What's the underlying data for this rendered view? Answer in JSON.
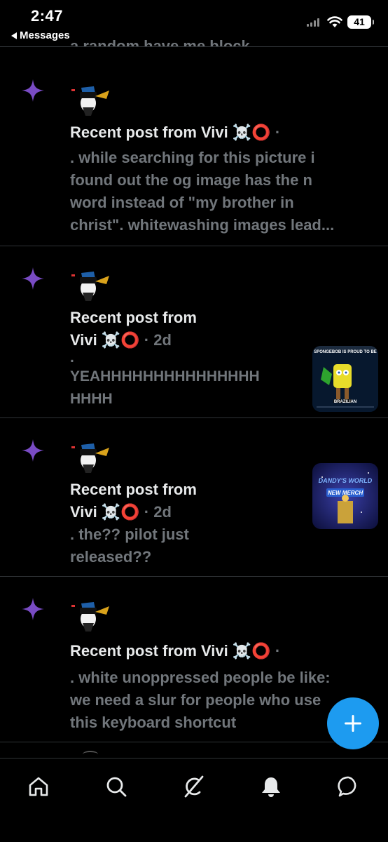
{
  "status_bar": {
    "time": "2:47",
    "back_label": "Messages",
    "battery": "41"
  },
  "previous_post_cutoff": "a random have me block...",
  "notifications": [
    {
      "title": "Recent post from Vivi",
      "title_line2": "",
      "emoji": "☠️⭕",
      "meta": "·",
      "snippet_lines": [
        ". while searching for this picture i",
        "found out the og image has the n",
        "word instead of \"my brother in",
        "christ\". whitewashing images lead..."
      ],
      "has_thumbnail": false
    },
    {
      "title": "Recent post from",
      "title_line2": "Vivi",
      "emoji": "☠️⭕",
      "meta": "· 2d",
      "snippet_lines": [
        ".",
        "YEAHHHHHHHHHHHHHHH",
        "HHHH"
      ],
      "has_thumbnail": true,
      "thumbnail_text": "SPONGEBOB IS PROUD TO BE",
      "thumbnail_caption": "BRAZILIAN"
    },
    {
      "title": "Recent post from",
      "title_line2": "Vivi",
      "emoji": "☠️⭕",
      "meta": "· 2d",
      "snippet_lines": [
        ". the?? pilot just",
        "released??"
      ],
      "has_thumbnail": true,
      "thumbnail_text": "DANDY'S WORLD",
      "thumbnail_caption": "NEW MERCH"
    },
    {
      "title": "Recent post from Vivi",
      "title_line2": "",
      "emoji": "☠️⭕",
      "meta": "·",
      "snippet_lines": [
        ". white unoppressed people be like:",
        "we need a slur for people who use",
        "this keyboard shortcut"
      ],
      "has_thumbnail": false
    }
  ],
  "fab": {
    "icon": "plus-icon"
  },
  "tabs": [
    {
      "name": "home-icon"
    },
    {
      "name": "search-icon"
    },
    {
      "name": "grok-icon"
    },
    {
      "name": "bell-icon"
    },
    {
      "name": "messages-icon"
    }
  ],
  "colors": {
    "background": "#000000",
    "text_primary": "#e7e9ea",
    "text_secondary": "#71767b",
    "accent_purple": "#794bc4",
    "fab_blue": "#1d9bf0",
    "divider": "#2f3336"
  }
}
